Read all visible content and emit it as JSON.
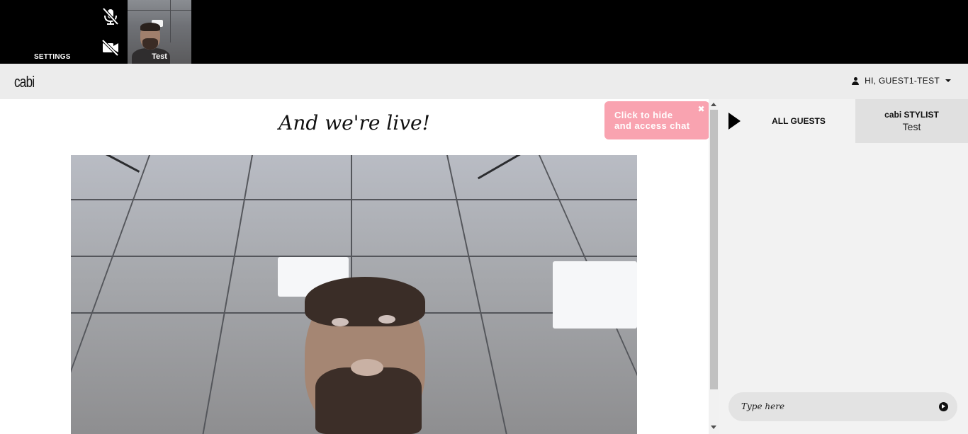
{
  "top_bar": {
    "settings_label": "SETTINGS",
    "self_view_name": "Test"
  },
  "header": {
    "logo_text": "cabi",
    "user_menu_label": "HI, GUEST1-TEST"
  },
  "main": {
    "live_title": "And we're live!"
  },
  "chat_hint": {
    "line1": "Click to hide",
    "line2": "and access chat",
    "close": "✖"
  },
  "sidebar": {
    "tab_all_guests": "ALL GUESTS",
    "tab_stylist_title": "cabi STYLIST",
    "tab_stylist_name": "Test",
    "chat_placeholder": "Type here"
  },
  "colors": {
    "top_bar": "#000000",
    "header_bg": "#ececec",
    "chat_hint_bg": "#f9a3b0",
    "sidebar_bg": "#f2f2f2",
    "stylist_tab_bg": "#e0e0e0"
  },
  "icons": {
    "mic": "mic-muted-icon",
    "camera": "camera-off-icon",
    "user": "user-icon",
    "caret": "caret-down-icon",
    "collapse": "play-arrow-icon",
    "send": "arrow-circle-right-icon",
    "close": "close-icon"
  }
}
